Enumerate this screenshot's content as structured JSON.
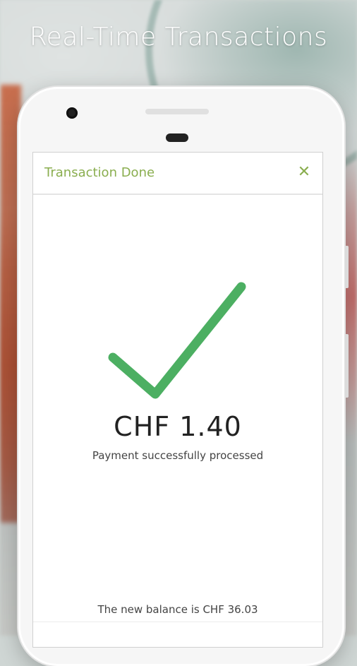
{
  "headline": "Real-Time Transactions",
  "dialog": {
    "title": "Transaction Done",
    "close_icon": "close-icon",
    "check_icon": "checkmark-icon",
    "amount": "CHF 1.40",
    "status": "Payment successfully processed",
    "balance": "The new balance is CHF 36.03"
  },
  "colors": {
    "accent": "#8aae4f",
    "check": "#4caf62"
  }
}
